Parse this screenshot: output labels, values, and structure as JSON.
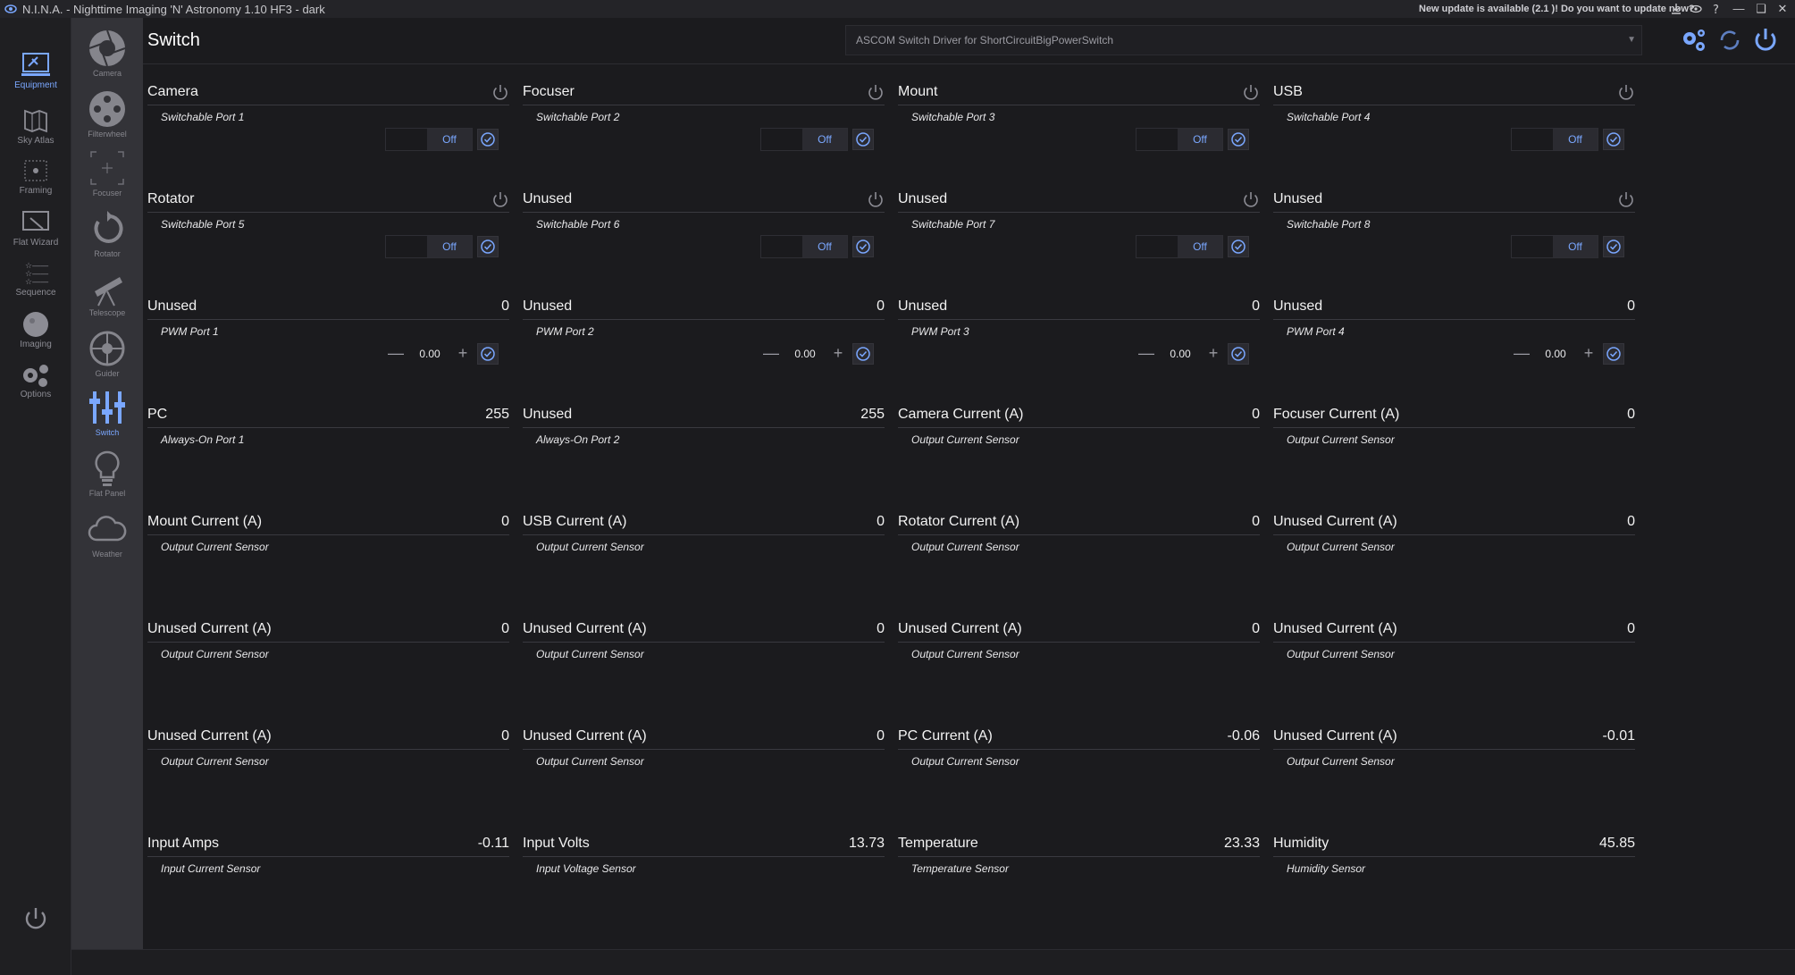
{
  "titlebar": {
    "title": "N.I.N.A. - Nighttime Imaging 'N' Astronomy 1.10 HF3   -  dark",
    "update_notice": "New update is available (2.1 )! Do you want to update now?"
  },
  "rail": {
    "items": [
      {
        "label": "Equipment",
        "icon": "equipment-icon",
        "active": true
      },
      {
        "label": "Sky Atlas",
        "icon": "sky-atlas-icon"
      },
      {
        "label": "Framing",
        "icon": "framing-icon"
      },
      {
        "label": "Flat Wizard",
        "icon": "flat-wizard-icon"
      },
      {
        "label": "Sequence",
        "icon": "sequence-icon"
      },
      {
        "label": "Imaging",
        "icon": "imaging-icon"
      },
      {
        "label": "Options",
        "icon": "options-icon"
      }
    ]
  },
  "subrail": {
    "items": [
      {
        "label": "Camera",
        "icon": "camera-icon"
      },
      {
        "label": "Filterwheel",
        "icon": "filterwheel-icon"
      },
      {
        "label": "Focuser",
        "icon": "focuser-icon"
      },
      {
        "label": "Rotator",
        "icon": "rotator-icon"
      },
      {
        "label": "Telescope",
        "icon": "telescope-icon"
      },
      {
        "label": "Guider",
        "icon": "guider-icon"
      },
      {
        "label": "Switch",
        "icon": "switch-icon",
        "active": true
      },
      {
        "label": "Flat Panel",
        "icon": "flat-panel-icon"
      },
      {
        "label": "Weather",
        "icon": "weather-icon"
      }
    ]
  },
  "header": {
    "title": "Switch",
    "driver": "ASCOM Switch Driver for ShortCircuitBigPowerSwitch"
  },
  "accent": "#7aa7ff",
  "switches": [
    {
      "name": "Camera",
      "desc": "Switchable Port 1",
      "kind": "toggle",
      "state": "Off"
    },
    {
      "name": "Focuser",
      "desc": "Switchable Port 2",
      "kind": "toggle",
      "state": "Off"
    },
    {
      "name": "Mount",
      "desc": "Switchable Port 3",
      "kind": "toggle",
      "state": "Off"
    },
    {
      "name": "USB",
      "desc": "Switchable Port 4",
      "kind": "toggle",
      "state": "Off"
    },
    {
      "name": "Rotator",
      "desc": "Switchable Port 5",
      "kind": "toggle",
      "state": "Off"
    },
    {
      "name": "Unused",
      "desc": "Switchable Port 6",
      "kind": "toggle",
      "state": "Off"
    },
    {
      "name": "Unused",
      "desc": "Switchable Port 7",
      "kind": "toggle",
      "state": "Off"
    },
    {
      "name": "Unused",
      "desc": "Switchable Port 8",
      "kind": "toggle",
      "state": "Off"
    },
    {
      "name": "Unused",
      "desc": "PWM Port 1",
      "kind": "pwm",
      "value": "0",
      "setpoint": "0.00"
    },
    {
      "name": "Unused",
      "desc": "PWM Port 2",
      "kind": "pwm",
      "value": "0",
      "setpoint": "0.00"
    },
    {
      "name": "Unused",
      "desc": "PWM Port 3",
      "kind": "pwm",
      "value": "0",
      "setpoint": "0.00"
    },
    {
      "name": "Unused",
      "desc": "PWM Port 4",
      "kind": "pwm",
      "value": "0",
      "setpoint": "0.00"
    },
    {
      "name": "PC",
      "desc": "Always-On Port 1",
      "kind": "readonly",
      "value": "255"
    },
    {
      "name": "Unused",
      "desc": "Always-On Port 2",
      "kind": "readonly",
      "value": "255"
    },
    {
      "name": "Camera Current (A)",
      "desc": "Output Current Sensor",
      "kind": "readonly",
      "value": "0"
    },
    {
      "name": "Focuser Current (A)",
      "desc": "Output Current Sensor",
      "kind": "readonly",
      "value": "0"
    },
    {
      "name": "Mount Current (A)",
      "desc": "Output Current Sensor",
      "kind": "readonly",
      "value": "0"
    },
    {
      "name": "USB Current (A)",
      "desc": "Output Current Sensor",
      "kind": "readonly",
      "value": "0"
    },
    {
      "name": "Rotator Current (A)",
      "desc": "Output Current Sensor",
      "kind": "readonly",
      "value": "0"
    },
    {
      "name": "Unused Current (A)",
      "desc": "Output Current Sensor",
      "kind": "readonly",
      "value": "0"
    },
    {
      "name": "Unused Current (A)",
      "desc": "Output Current Sensor",
      "kind": "readonly",
      "value": "0"
    },
    {
      "name": "Unused Current (A)",
      "desc": "Output Current Sensor",
      "kind": "readonly",
      "value": "0"
    },
    {
      "name": "Unused Current (A)",
      "desc": "Output Current Sensor",
      "kind": "readonly",
      "value": "0"
    },
    {
      "name": "Unused Current (A)",
      "desc": "Output Current Sensor",
      "kind": "readonly",
      "value": "0"
    },
    {
      "name": "Unused Current (A)",
      "desc": "Output Current Sensor",
      "kind": "readonly",
      "value": "0"
    },
    {
      "name": "Unused Current (A)",
      "desc": "Output Current Sensor",
      "kind": "readonly",
      "value": "0"
    },
    {
      "name": "PC Current (A)",
      "desc": "Output Current Sensor",
      "kind": "readonly",
      "value": "-0.06"
    },
    {
      "name": "Unused Current (A)",
      "desc": "Output Current Sensor",
      "kind": "readonly",
      "value": "-0.01"
    },
    {
      "name": "Input Amps",
      "desc": "Input Current Sensor",
      "kind": "readonly",
      "value": "-0.11"
    },
    {
      "name": "Input Volts",
      "desc": "Input Voltage Sensor",
      "kind": "readonly",
      "value": "13.73"
    },
    {
      "name": "Temperature",
      "desc": "Temperature Sensor",
      "kind": "readonly",
      "value": "23.33"
    },
    {
      "name": "Humidity",
      "desc": "Humidity Sensor",
      "kind": "readonly",
      "value": "45.85"
    }
  ]
}
